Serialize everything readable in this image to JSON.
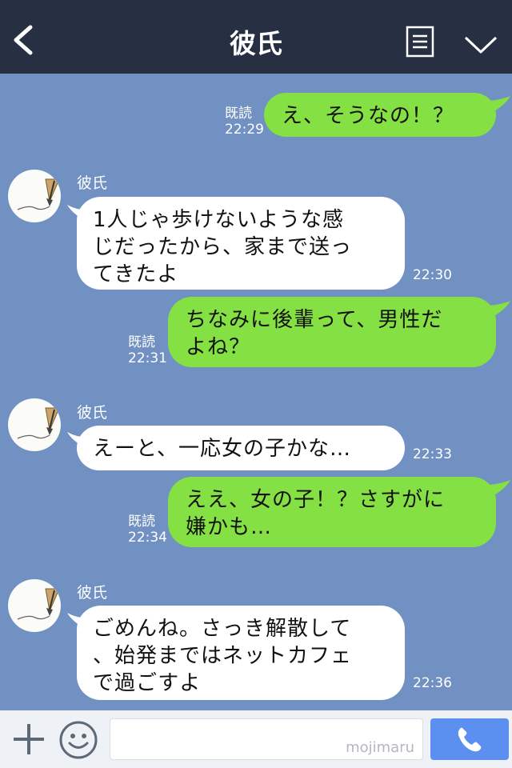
{
  "header": {
    "title": "彼氏"
  },
  "messages": [
    {
      "side": "right",
      "text": "え、そうなの！？",
      "read": "既読",
      "time": "22:29"
    },
    {
      "side": "left",
      "sender": "彼氏",
      "text": "1人じゃ歩けないような感\nじだったから、家まで送っ\nてきたよ",
      "time": "22:30"
    },
    {
      "side": "right",
      "text": "ちなみに後輩って、男性だ\nよね？",
      "read": "既読",
      "time": "22:31"
    },
    {
      "side": "left",
      "sender": "彼氏",
      "text": "えーと、一応女の子かな…",
      "time": "22:33"
    },
    {
      "side": "right",
      "text": "ええ、女の子！？さすがに\n嫌かも…",
      "read": "既読",
      "time": "22:34"
    },
    {
      "side": "left",
      "sender": "彼氏",
      "text": "ごめんね。さっき解散して\n、始発まではネットカフェ\nで過ごすよ",
      "time": "22:36"
    }
  ],
  "input": {
    "watermark": "mojimaru"
  },
  "icons": {
    "back": "back-chevron-icon",
    "menu": "menu-list-icon",
    "collapse": "chevron-down-icon",
    "add": "plus-icon",
    "sticker": "smiley-icon",
    "call": "phone-icon",
    "avatar": "fountain-pen-avatar"
  },
  "colors": {
    "header": "#263042",
    "background": "#7191c2",
    "sent_bubble": "#85e043",
    "received_bubble": "#ffffff",
    "send_button": "#5b8ff0"
  }
}
